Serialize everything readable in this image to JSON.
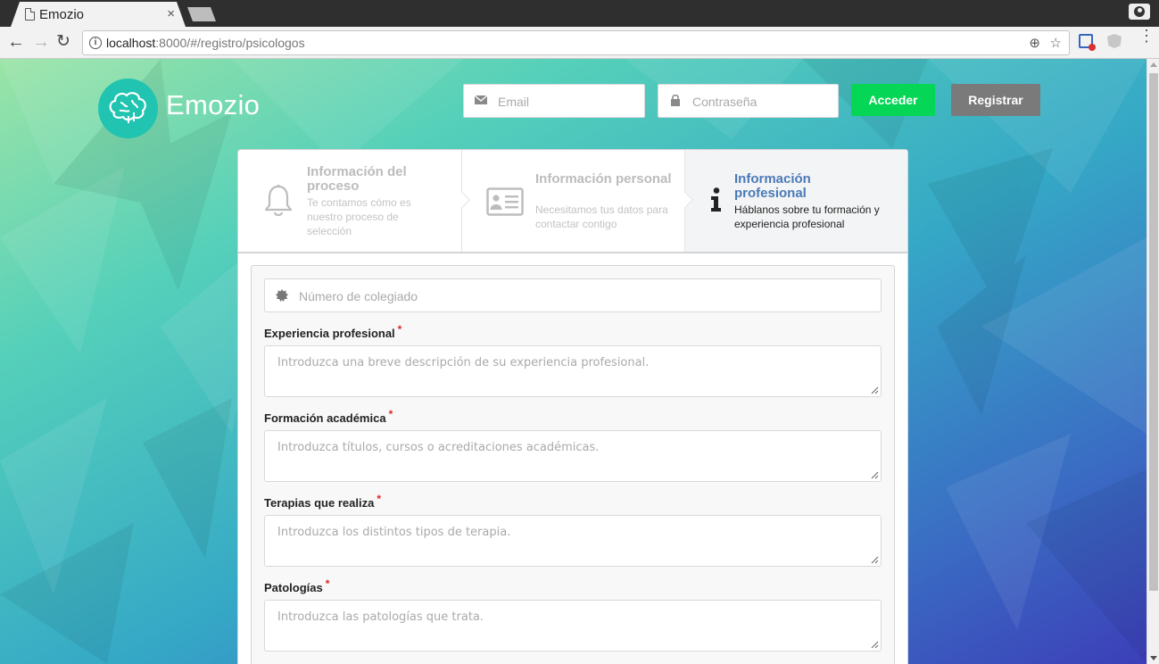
{
  "browser": {
    "tab_title": "Emozio",
    "tab_close": "×",
    "url_host": "localhost",
    "url_rest": ":8000/#/registro/psicologos"
  },
  "header": {
    "brand": "Emozio",
    "email_placeholder": "Email",
    "password_placeholder": "Contraseña",
    "login_label": "Acceder",
    "register_label": "Registrar"
  },
  "steps": [
    {
      "title": "Información del proceso",
      "description": "Te contamos cómo es nuestro proceso de selección",
      "icon": "bell-icon",
      "active": false
    },
    {
      "title": "Información personal",
      "description": "Necesitamos tus datos para contactar contigo",
      "icon": "id-card-icon",
      "active": false
    },
    {
      "title": "Información profesional",
      "description": "Háblanos sobre tu formación y experiencia profesional",
      "icon": "info-icon",
      "active": true
    }
  ],
  "form": {
    "collegiate_placeholder": "Número de colegiado",
    "required_mark": "*",
    "fields": [
      {
        "label": "Experiencia profesional",
        "placeholder": "Introduzca una breve descripción de su experiencia profesional."
      },
      {
        "label": "Formación académica",
        "placeholder": "Introduzca títulos, cursos o acreditaciones académicas."
      },
      {
        "label": "Terapias que realiza",
        "placeholder": "Introduzca los distintos tipos de terapia."
      },
      {
        "label": "Patologías",
        "placeholder": "Introduzca las patologías que trata."
      }
    ]
  },
  "colors": {
    "accent_green": "#05d655",
    "register_gray": "#7a7a7a",
    "active_step": "#4a7ab8",
    "required": "#db2828",
    "logo": "#20c4b0"
  }
}
